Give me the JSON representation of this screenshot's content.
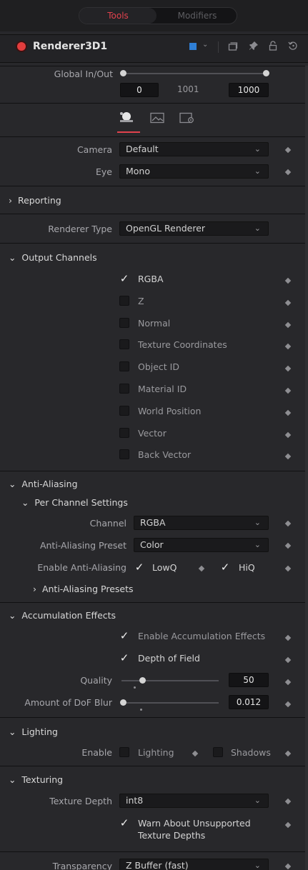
{
  "tabs": {
    "tools": "Tools",
    "modifiers": "Modifiers"
  },
  "node": {
    "title": "Renderer3D1"
  },
  "global": {
    "label": "Global In/Out",
    "start": "0",
    "middle": "1001",
    "end": "1000"
  },
  "camera": {
    "label": "Camera",
    "value": "Default"
  },
  "eye": {
    "label": "Eye",
    "value": "Mono"
  },
  "reporting": {
    "label": "Reporting"
  },
  "renderer_type": {
    "label": "Renderer Type",
    "value": "OpenGL Renderer"
  },
  "output_channels": {
    "label": "Output Channels",
    "items": [
      "RGBA",
      "Z",
      "Normal",
      "Texture Coordinates",
      "Object ID",
      "Material ID",
      "World Position",
      "Vector",
      "Back Vector"
    ]
  },
  "anti_aliasing": {
    "label": "Anti-Aliasing",
    "per_channel": "Per Channel Settings",
    "channel_label": "Channel",
    "channel_value": "RGBA",
    "preset_label": "Anti-Aliasing Preset",
    "preset_value": "Color",
    "enable_label": "Enable Anti-Aliasing",
    "lowq": "LowQ",
    "hiq": "HiQ",
    "presets": "Anti-Aliasing Presets"
  },
  "accumulation": {
    "label": "Accumulation Effects",
    "enable": "Enable Accumulation Effects",
    "dof": "Depth of Field",
    "quality_label": "Quality",
    "quality_value": "50",
    "dof_blur_label": "Amount of DoF Blur",
    "dof_blur_value": "0.012"
  },
  "lighting": {
    "label": "Lighting",
    "enable_label": "Enable",
    "lighting": "Lighting",
    "shadows": "Shadows"
  },
  "texturing": {
    "label": "Texturing",
    "depth_label": "Texture Depth",
    "depth_value": "int8",
    "warn_line1": "Warn About Unsupported",
    "warn_line2": "Texture Depths"
  },
  "transparency": {
    "label": "Transparency",
    "value": "Z Buffer (fast)"
  }
}
